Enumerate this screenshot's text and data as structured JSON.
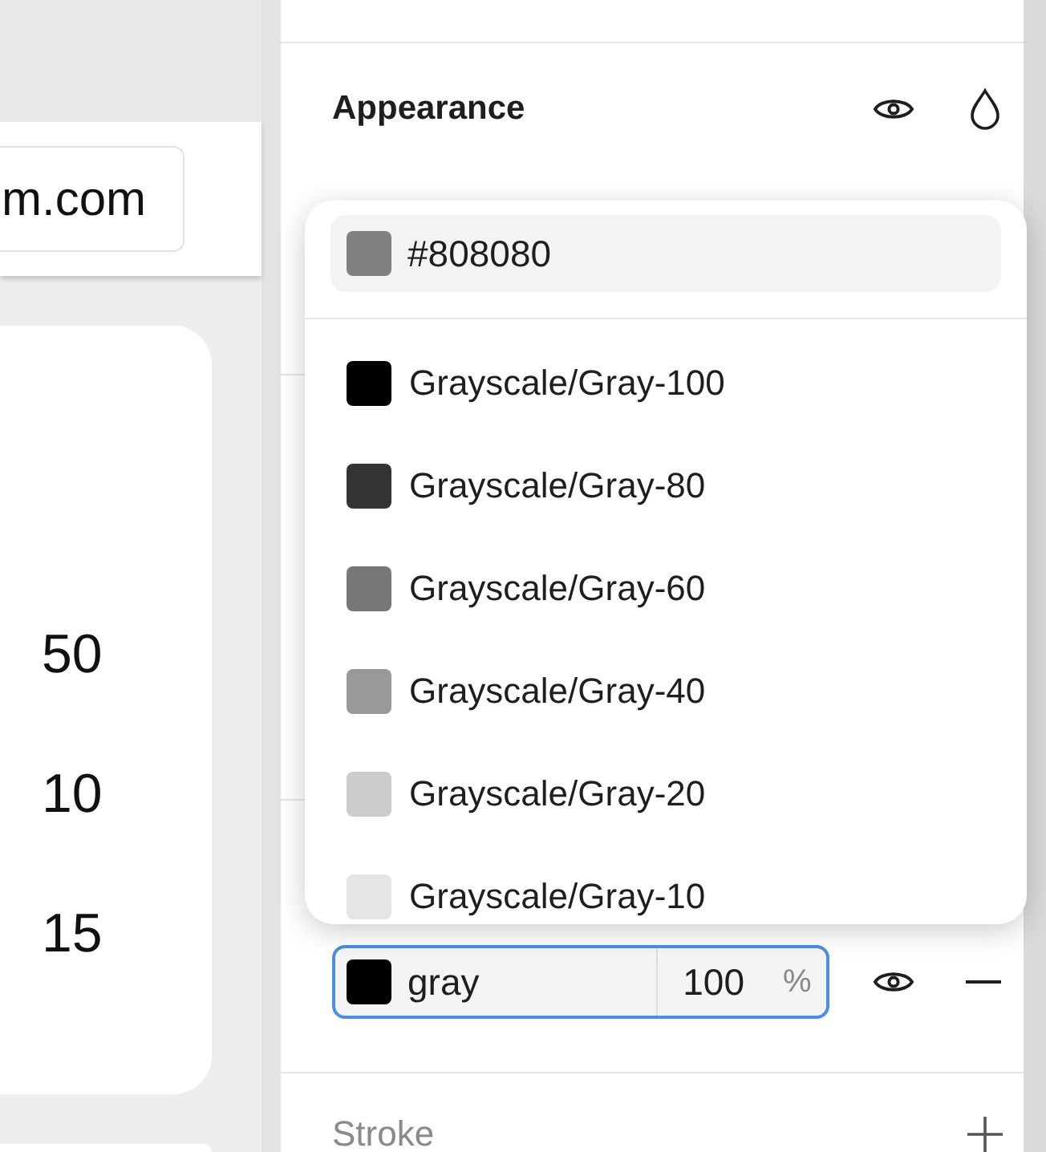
{
  "canvas": {
    "url_field": {
      "value": "m.com"
    },
    "card_values": [
      "50",
      "10",
      "15"
    ]
  },
  "panel": {
    "appearance": {
      "title": "Appearance"
    },
    "fill": {
      "color": "#000000",
      "name": "gray",
      "opacity": "100",
      "unit": "%",
      "focused": true
    },
    "stroke": {
      "title": "Stroke"
    }
  },
  "color_dropdown": {
    "search": {
      "value": "#808080",
      "color": "#808080"
    },
    "options": [
      {
        "label": "Grayscale/Gray-100",
        "color": "#000000",
        "selected": false
      },
      {
        "label": "Grayscale/Gray-80",
        "color": "#333333",
        "selected": false
      },
      {
        "label": "Grayscale/Gray-60",
        "color": "#777777",
        "selected": false
      },
      {
        "label": "Grayscale/Gray-40",
        "color": "#999999",
        "selected": false
      },
      {
        "label": "Grayscale/Gray-20",
        "color": "#cccccc",
        "selected": false
      },
      {
        "label": "Grayscale/Gray-10",
        "color": "#e5e5e5",
        "selected": false
      }
    ]
  }
}
